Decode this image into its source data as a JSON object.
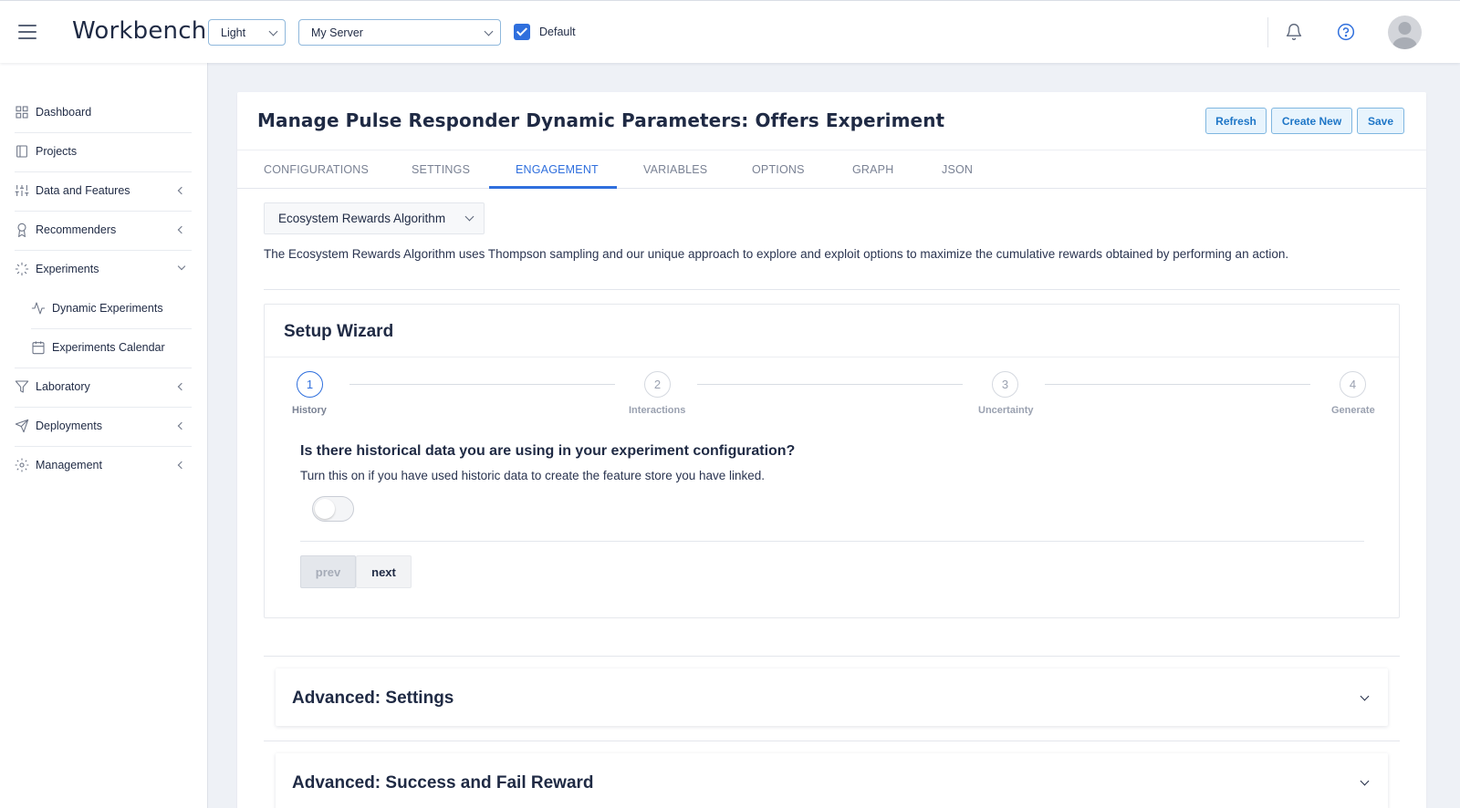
{
  "header": {
    "brand": "Workbench",
    "theme_select": "Light",
    "server_select": "My Server",
    "default_checkbox_label": "Default",
    "accent_color": "#2f6fdd"
  },
  "sidebar": {
    "items": [
      {
        "label": "Dashboard",
        "icon": "grid-icon"
      },
      {
        "label": "Projects",
        "icon": "book-icon"
      },
      {
        "label": "Data and Features",
        "icon": "sliders-icon"
      },
      {
        "label": "Recommenders",
        "icon": "award-icon"
      },
      {
        "label": "Experiments",
        "icon": "loader-icon"
      },
      {
        "label": "Dynamic Experiments",
        "icon": "activity-icon"
      },
      {
        "label": "Experiments Calendar",
        "icon": "calendar-icon"
      },
      {
        "label": "Laboratory",
        "icon": "filter-icon"
      },
      {
        "label": "Deployments",
        "icon": "send-icon"
      },
      {
        "label": "Management",
        "icon": "gear-icon"
      }
    ]
  },
  "main": {
    "title": "Manage Pulse Responder Dynamic Parameters: Offers Experiment",
    "buttons": {
      "refresh": "Refresh",
      "create_new": "Create New",
      "save": "Save"
    },
    "tabs": [
      {
        "label": "CONFIGURATIONS"
      },
      {
        "label": "SETTINGS"
      },
      {
        "label": "ENGAGEMENT"
      },
      {
        "label": "VARIABLES"
      },
      {
        "label": "OPTIONS"
      },
      {
        "label": "GRAPH"
      },
      {
        "label": "JSON"
      }
    ],
    "active_tab": "ENGAGEMENT",
    "algorithm_select": "Ecosystem Rewards Algorithm",
    "algorithm_description": "The Ecosystem Rewards Algorithm uses Thompson sampling and our unique approach to explore and exploit options to maximize the cumulative rewards obtained by performing an action.",
    "wizard": {
      "title": "Setup Wizard",
      "steps": [
        {
          "number": "1",
          "label": "History"
        },
        {
          "number": "2",
          "label": "Interactions"
        },
        {
          "number": "3",
          "label": "Uncertainty"
        },
        {
          "number": "4",
          "label": "Generate"
        }
      ],
      "question": "Is there historical data you are using in your experiment configuration?",
      "question_help": "Turn this on if you have used historic data to create the feature store you have linked.",
      "prev_label": "prev",
      "next_label": "next"
    },
    "advanced_sections": [
      {
        "title": "Advanced: Settings"
      },
      {
        "title": "Advanced: Success and Fail Reward"
      }
    ]
  }
}
